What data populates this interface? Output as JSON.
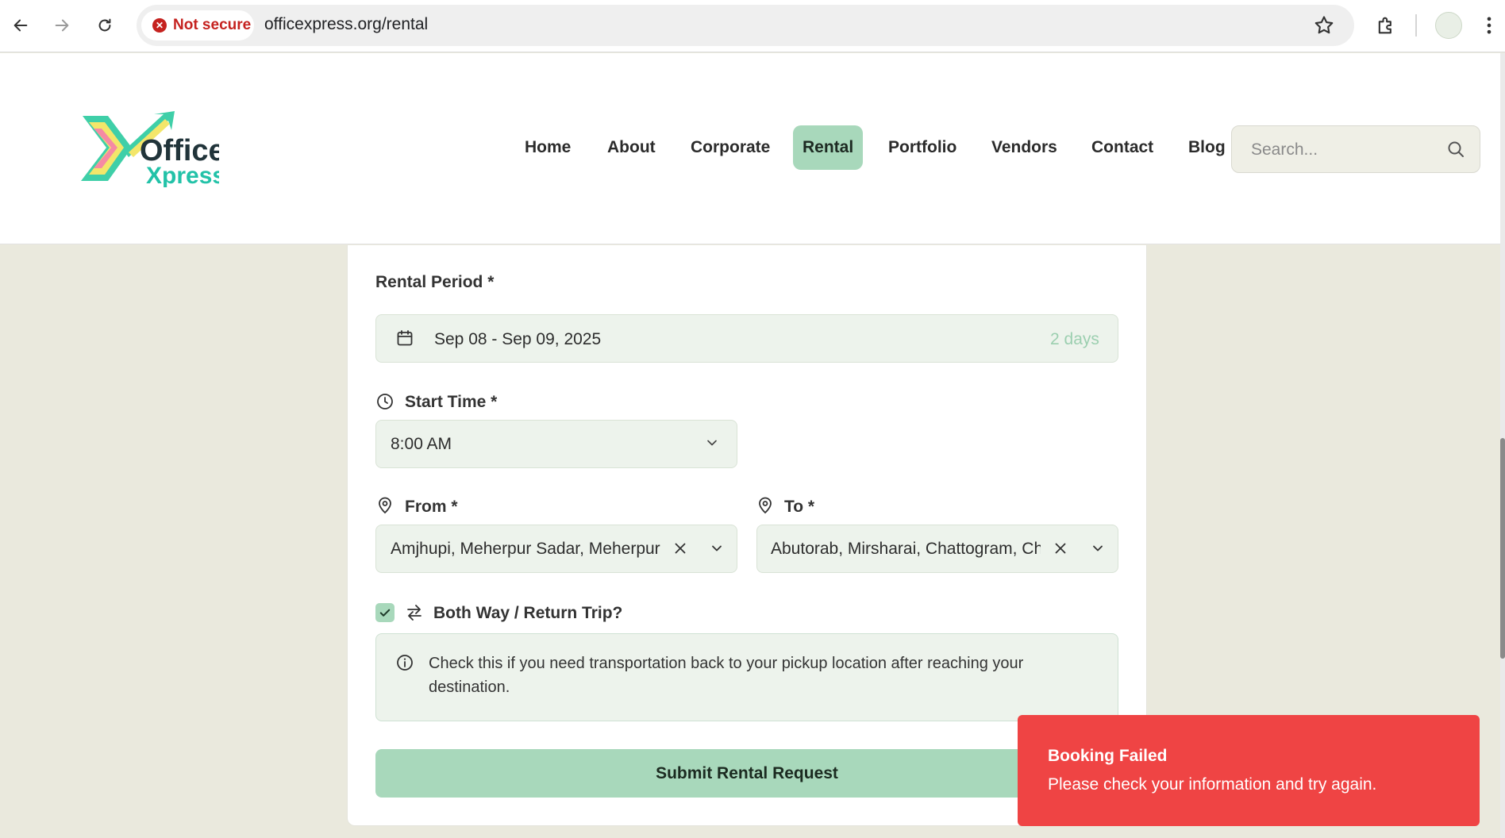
{
  "browser": {
    "security_label": "Not secure",
    "url": "officexpress.org/rental"
  },
  "site": {
    "logo_line1": "Office",
    "logo_line2": "Xpress",
    "nav": [
      "Home",
      "About",
      "Corporate",
      "Rental",
      "Portfolio",
      "Vendors",
      "Contact",
      "Blog"
    ],
    "active_nav": "Rental",
    "search_placeholder": "Search..."
  },
  "form": {
    "rental_period_label": "Rental Period *",
    "rental_period_value": "Sep 08 - Sep 09, 2025",
    "rental_days": "2 days",
    "start_time_label": "Start Time *",
    "start_time_value": "8:00 AM",
    "from_label": "From *",
    "from_value": "Amjhupi, Meherpur Sadar, Meherpur, Khulna",
    "to_label": "To *",
    "to_value": "Abutorab, Mirsharai, Chattogram, Chattogram",
    "return_trip_label": "Both Way / Return Trip?",
    "return_trip_checked": true,
    "info_text": "Check this if you need transportation back to your pickup location after reaching your destination.",
    "submit_label": "Submit Rental Request"
  },
  "toast": {
    "title": "Booking Failed",
    "message": "Please check your information and try again."
  },
  "colors": {
    "accent": "#a8d8bb",
    "error": "#ef4444",
    "page_bg": "#eae9dd",
    "field_bg": "#edf3ec"
  }
}
